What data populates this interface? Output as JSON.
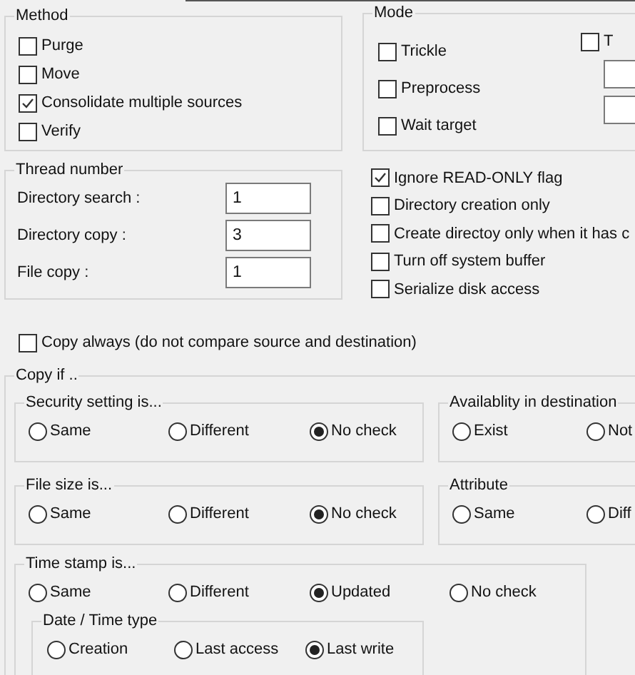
{
  "method": {
    "title": "Method",
    "options": [
      {
        "label": "Purge",
        "checked": false
      },
      {
        "label": "Move",
        "checked": false
      },
      {
        "label": "Consolidate multiple sources",
        "checked": true
      },
      {
        "label": "Verify",
        "checked": false
      }
    ]
  },
  "mode": {
    "title": "Mode",
    "options": [
      {
        "label": "Trickle",
        "checked": false
      },
      {
        "label": "Preprocess",
        "checked": false
      },
      {
        "label": "Wait target",
        "checked": false
      }
    ],
    "extra_option": {
      "label": "T",
      "checked": false
    },
    "spin_fields": [
      {
        "kind": "spin"
      },
      {
        "kind": "spin"
      }
    ]
  },
  "thread_number": {
    "title": "Thread number",
    "fields": [
      {
        "label": "Directory search :",
        "value": "1"
      },
      {
        "label": "Directory copy :",
        "value": "3"
      },
      {
        "label": "File copy :",
        "value": "1"
      }
    ]
  },
  "flags": [
    {
      "label": "Ignore READ-ONLY flag",
      "checked": true
    },
    {
      "label": "Directory creation only",
      "checked": false
    },
    {
      "label": "Create directoy only when it has c",
      "checked": false
    },
    {
      "label": "Turn off system buffer",
      "checked": false
    },
    {
      "label": "Serialize disk access",
      "checked": false
    }
  ],
  "copy_always": {
    "label": "Copy always (do not compare source and destination)",
    "checked": false
  },
  "copy_if": {
    "title": "Copy if ..",
    "groups": [
      {
        "title": "Security setting is...",
        "options": [
          {
            "label": "Same",
            "selected": false
          },
          {
            "label": "Different",
            "selected": false
          },
          {
            "label": "No check",
            "selected": true
          }
        ]
      },
      {
        "title": "Availablity in destination",
        "options": [
          {
            "label": "Exist",
            "selected": false
          },
          {
            "label": "Not",
            "selected": false
          }
        ]
      },
      {
        "title": "File size is...",
        "options": [
          {
            "label": "Same",
            "selected": false
          },
          {
            "label": "Different",
            "selected": false
          },
          {
            "label": "No check",
            "selected": true
          }
        ]
      },
      {
        "title": "Attribute",
        "options": [
          {
            "label": "Same",
            "selected": false
          },
          {
            "label": "Diff",
            "selected": false
          }
        ]
      }
    ],
    "time_stamp": {
      "title": "Time stamp is...",
      "options": [
        {
          "label": "Same",
          "selected": false
        },
        {
          "label": "Different",
          "selected": false
        },
        {
          "label": "Updated",
          "selected": true
        },
        {
          "label": "No check",
          "selected": false
        }
      ],
      "date_time_type": {
        "title": "Date / Time type",
        "options": [
          {
            "label": "Creation",
            "selected": false
          },
          {
            "label": "Last access",
            "selected": false
          },
          {
            "label": "Last write",
            "selected": true
          }
        ]
      }
    }
  }
}
